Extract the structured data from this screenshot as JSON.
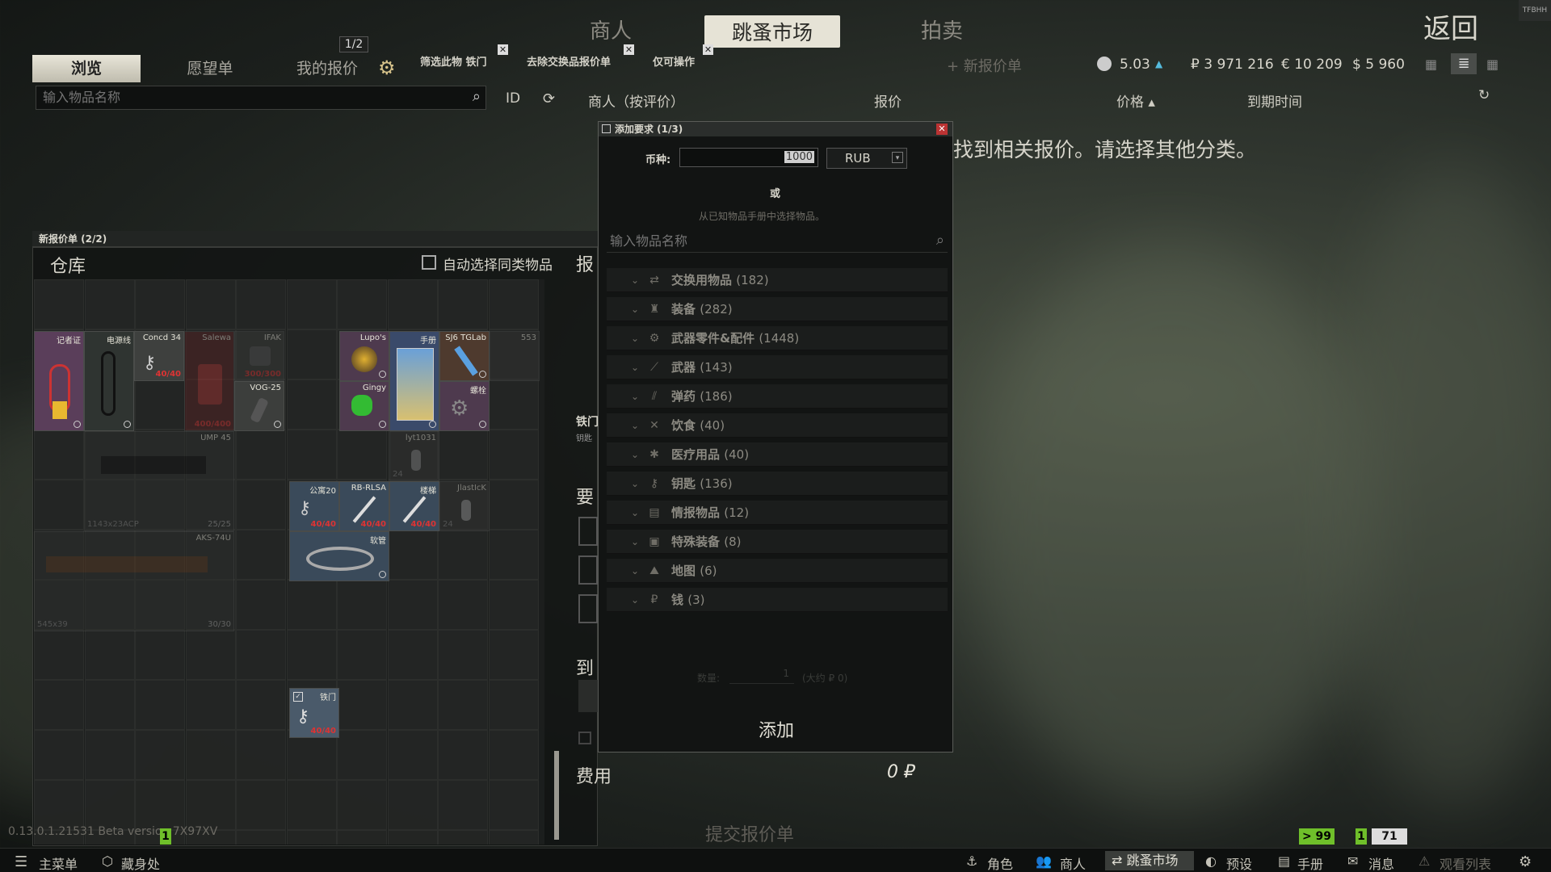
{
  "top_nav": {
    "traders": "商人",
    "flea_market": "跳蚤市场",
    "auction": "拍卖",
    "back": "返回"
  },
  "corner_logo": "TFBHH",
  "tabs": {
    "browse": "浏览",
    "wishlist": "愿望单",
    "my_offers": "我的报价",
    "offer_count": "1/2"
  },
  "filter_chips": [
    "筛选此物 铁门",
    "去除交换品报价单",
    "仅可操作"
  ],
  "add_offer": "+ 新报价单",
  "currency": {
    "rep": "5.03",
    "rub": "₽ 3 971 216",
    "eur": "€ 10 209",
    "usd": "$ 5 960"
  },
  "search": {
    "placeholder": "输入物品名称"
  },
  "columns": {
    "id": "ID",
    "trader": "商人（按评价）",
    "offer": "报价",
    "price": "价格 ▴",
    "expire": "到期时间"
  },
  "no_offers_msg": "找到相关报价。请选择其他分类。",
  "new_offer_panel": {
    "title": "新报价单 (2/2)",
    "stash": "仓库",
    "auto_select": "自动选择同类物品",
    "right_headers": {
      "offer": "报",
      "item": "铁门",
      "item_sub": "钥匙",
      "req": "要",
      "to": "到",
      "fee_label": "费用",
      "fee_value": "0 ₽",
      "submit": "提交报价单"
    }
  },
  "items": [
    {
      "label": "记者证",
      "dur": ""
    },
    {
      "label": "电源线",
      "dur": ""
    },
    {
      "label": "Concd 34",
      "dur": "40/40"
    },
    {
      "label": "Salewa",
      "dur": "400/400"
    },
    {
      "label": "IFAK",
      "dur": "300/300"
    },
    {
      "label": "Lupo's",
      "dur": ""
    },
    {
      "label": "手册",
      "dur": ""
    },
    {
      "label": "SJ6 TGLab",
      "dur": ""
    },
    {
      "label": "553",
      "dur": ""
    },
    {
      "label": "VOG-25",
      "dur": ""
    },
    {
      "label": "Gingy",
      "dur": ""
    },
    {
      "label": "螺栓",
      "dur": ""
    },
    {
      "label": "UMP 45",
      "dur": ""
    },
    {
      "label": "1143x23ACP",
      "dur": "25/25"
    },
    {
      "label": "lyt1031",
      "dur": ""
    },
    {
      "label": "公寓20",
      "dur": "40/40"
    },
    {
      "label": "RB-RLSA",
      "dur": "40/40"
    },
    {
      "label": "楼梯",
      "dur": "40/40"
    },
    {
      "label": "JlastIcK",
      "dur": "24"
    },
    {
      "label": "AKS-74U",
      "dur": ""
    },
    {
      "label": "545x39",
      "dur": "30/30"
    },
    {
      "label": "软管",
      "dur": ""
    },
    {
      "label": "铁门",
      "dur": "40/40"
    },
    {
      "label": "24",
      "dur": ""
    }
  ],
  "modal": {
    "title": "添加要求 (1/3)",
    "currency_label": "币种:",
    "currency_value": "1000",
    "currency_select": "RUB",
    "or": "或",
    "handbook_hint": "从已知物品手册中选择物品。",
    "search_placeholder": "输入物品名称",
    "categories": [
      {
        "name": "交换用物品",
        "count": "(182)",
        "icon": "barter-icon"
      },
      {
        "name": "装备",
        "count": "(282)",
        "icon": "gear-icon"
      },
      {
        "name": "武器零件&配件",
        "count": "(1448)",
        "icon": "weapon-parts-icon"
      },
      {
        "name": "武器",
        "count": "(143)",
        "icon": "weapon-icon"
      },
      {
        "name": "弹药",
        "count": "(186)",
        "icon": "ammo-icon"
      },
      {
        "name": "饮食",
        "count": "(40)",
        "icon": "food-icon"
      },
      {
        "name": "医疗用品",
        "count": "(40)",
        "icon": "medical-icon"
      },
      {
        "name": "钥匙",
        "count": "(136)",
        "icon": "key-icon"
      },
      {
        "name": "情报物品",
        "count": "(12)",
        "icon": "info-icon"
      },
      {
        "name": "特殊装备",
        "count": "(8)",
        "icon": "special-icon"
      },
      {
        "name": "地图",
        "count": "(6)",
        "icon": "map-icon"
      },
      {
        "name": "钱",
        "count": "(3)",
        "icon": "money-icon"
      }
    ],
    "quantity_label": "数量:",
    "quantity_value": "1",
    "approx": "(大约 ₽ 0)",
    "add_button": "添加"
  },
  "version": "0.13.0.1.21531 Beta version 7X97XV",
  "bottom_bar": {
    "main_menu": "主菜单",
    "hideout": "藏身处",
    "character": "角色",
    "traders": "商人",
    "flea": "跳蚤市场",
    "presets": "预设",
    "handbook": "手册",
    "messages": "消息",
    "watchlist": "观看列表",
    "badge_level": "> 99",
    "badge_count": "1",
    "online": "71",
    "version_badge": "1"
  }
}
